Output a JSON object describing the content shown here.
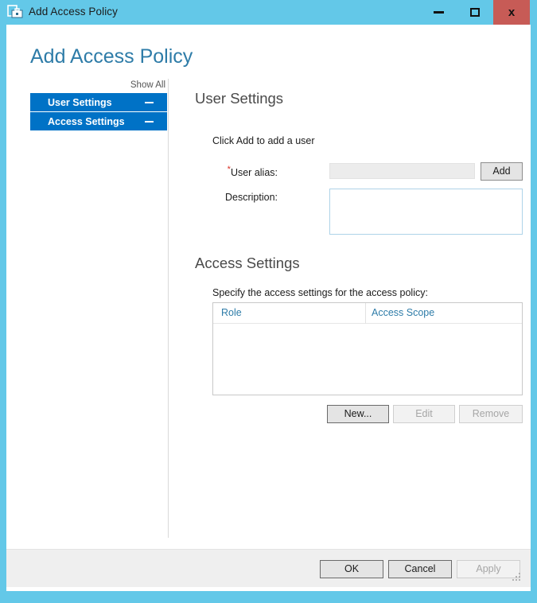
{
  "window": {
    "title": "Add Access Policy",
    "icon": "policy-toolbox-icon",
    "minimize_label": "–",
    "maximize_label": "□",
    "close_label": "x",
    "accent_color": "#63c8e8",
    "close_color": "#c75b56"
  },
  "page": {
    "title": "Add Access Policy",
    "title_color": "#2e7ca8"
  },
  "sidebar": {
    "show_all_label": "Show All",
    "items": [
      {
        "label": "User Settings",
        "collapse_icon": "minus-icon"
      },
      {
        "label": "Access Settings",
        "collapse_icon": "minus-icon"
      }
    ],
    "item_color": "#0072c6"
  },
  "user_settings": {
    "heading": "User Settings",
    "instruction": "Click Add to add a user",
    "alias_required_marker": "*",
    "alias_label": "User alias:",
    "alias_value": "",
    "alias_placeholder": "",
    "add_button": "Add",
    "description_label": "Description:",
    "description_value": "",
    "description_placeholder": ""
  },
  "access_settings": {
    "heading": "Access Settings",
    "instruction": "Specify the access settings for the access policy:",
    "table": {
      "columns": [
        "Role",
        "Access Scope"
      ],
      "rows": []
    },
    "buttons": [
      {
        "label": "New...",
        "enabled": true
      },
      {
        "label": "Edit",
        "enabled": false
      },
      {
        "label": "Remove",
        "enabled": false
      }
    ]
  },
  "footer": {
    "buttons": [
      {
        "label": "OK",
        "enabled": true
      },
      {
        "label": "Cancel",
        "enabled": true
      },
      {
        "label": "Apply",
        "enabled": false
      }
    ],
    "resize_grip": "resize-grip-icon"
  }
}
